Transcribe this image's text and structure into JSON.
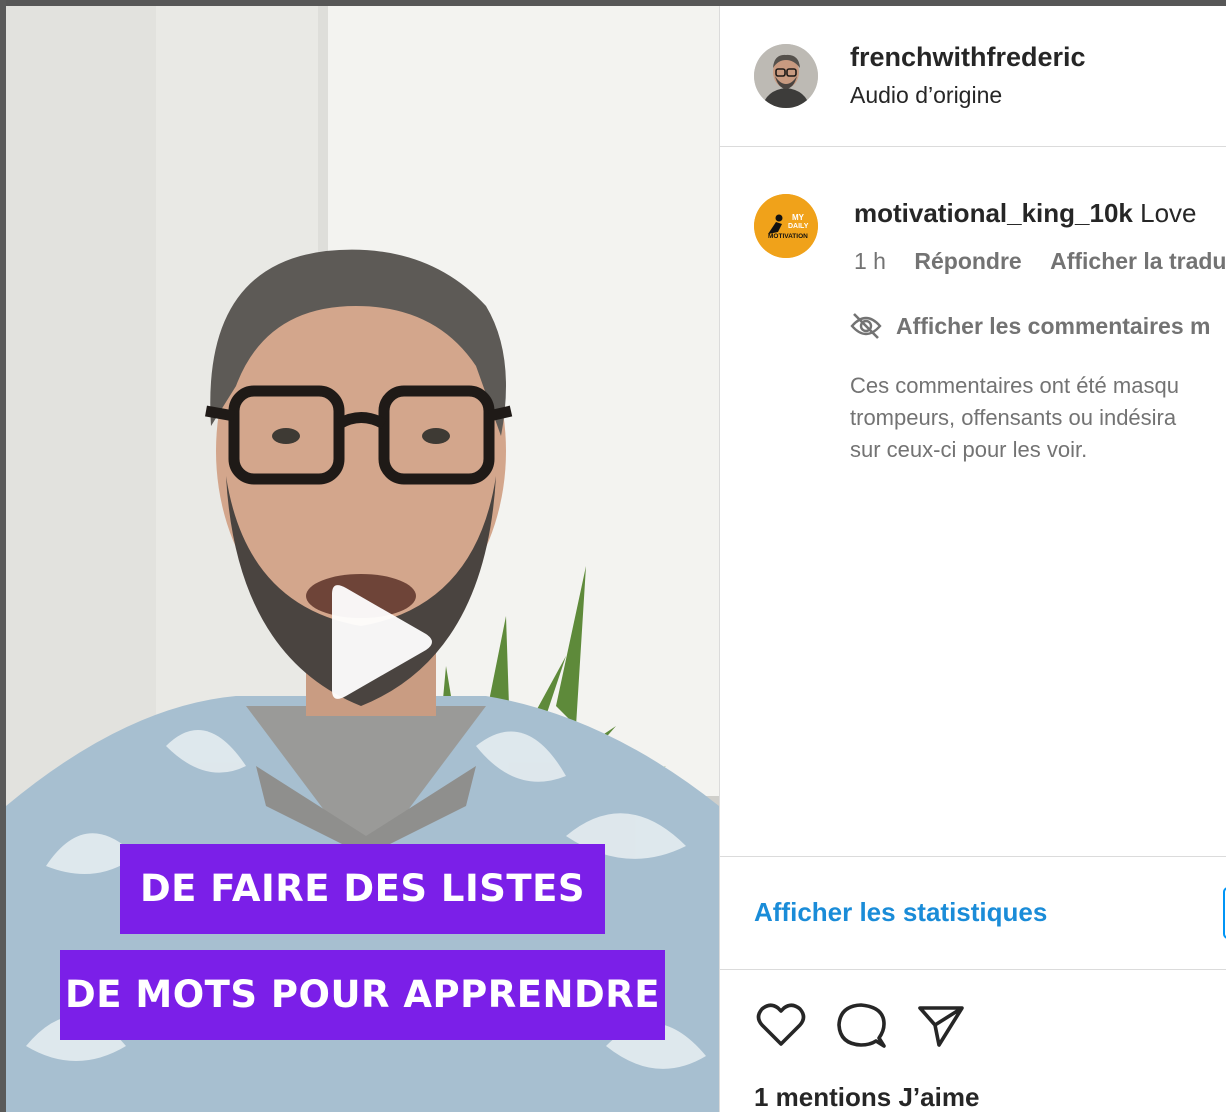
{
  "video": {
    "captions": [
      "DE FAIRE DES LISTES",
      "DE MOTS POUR APPRENDRE"
    ],
    "play_icon": "play-icon"
  },
  "header": {
    "username": "frenchwithfrederic",
    "audio": "Audio d’origine"
  },
  "comment": {
    "avatar_icon": "my-daily-motivation-logo",
    "username": "motivational_king_10k",
    "text": "Love",
    "time": "1 h",
    "reply_label": "Répondre",
    "translate_label": "Afficher la tradu"
  },
  "hidden_comments": {
    "icon": "eye-slash-icon",
    "toggle_label": "Afficher les commentaires m",
    "note_lines": [
      "Ces commentaires ont été masqu",
      "trompeurs, offensants ou indésira",
      "sur ceux-ci pour les voir."
    ]
  },
  "stats": {
    "link_label": "Afficher les statistiques"
  },
  "actions": {
    "icons": [
      "heart-icon",
      "comment-icon",
      "share-icon"
    ]
  },
  "likes": {
    "label": "1 mentions J’aime"
  },
  "colors": {
    "caption_bg": "#7b1fe8",
    "link": "#1a8cd8",
    "muted": "#737373",
    "text": "#262626"
  }
}
